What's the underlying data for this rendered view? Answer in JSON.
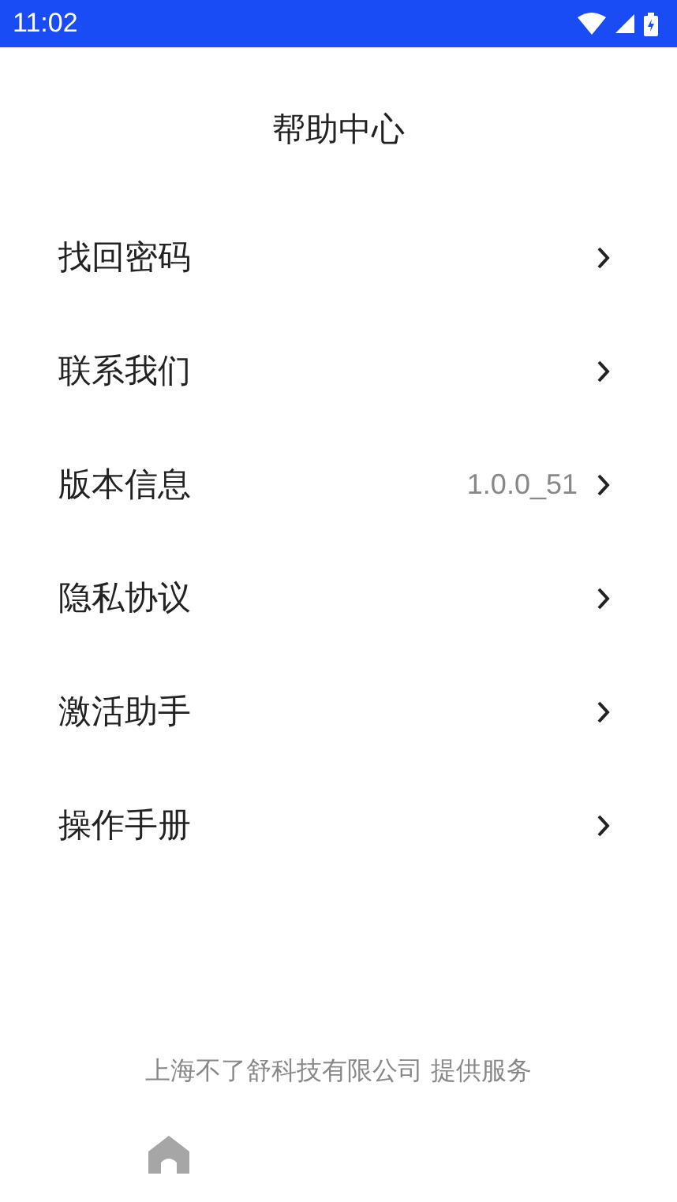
{
  "status_bar": {
    "time": "11:02"
  },
  "title": "帮助中心",
  "items": [
    {
      "label": "找回密码"
    },
    {
      "label": "联系我们"
    },
    {
      "label": "版本信息",
      "value": "1.0.0_51"
    },
    {
      "label": "隐私协议"
    },
    {
      "label": "激活助手"
    },
    {
      "label": "操作手册"
    }
  ],
  "footer": "上海不了舒科技有限公司 提供服务"
}
